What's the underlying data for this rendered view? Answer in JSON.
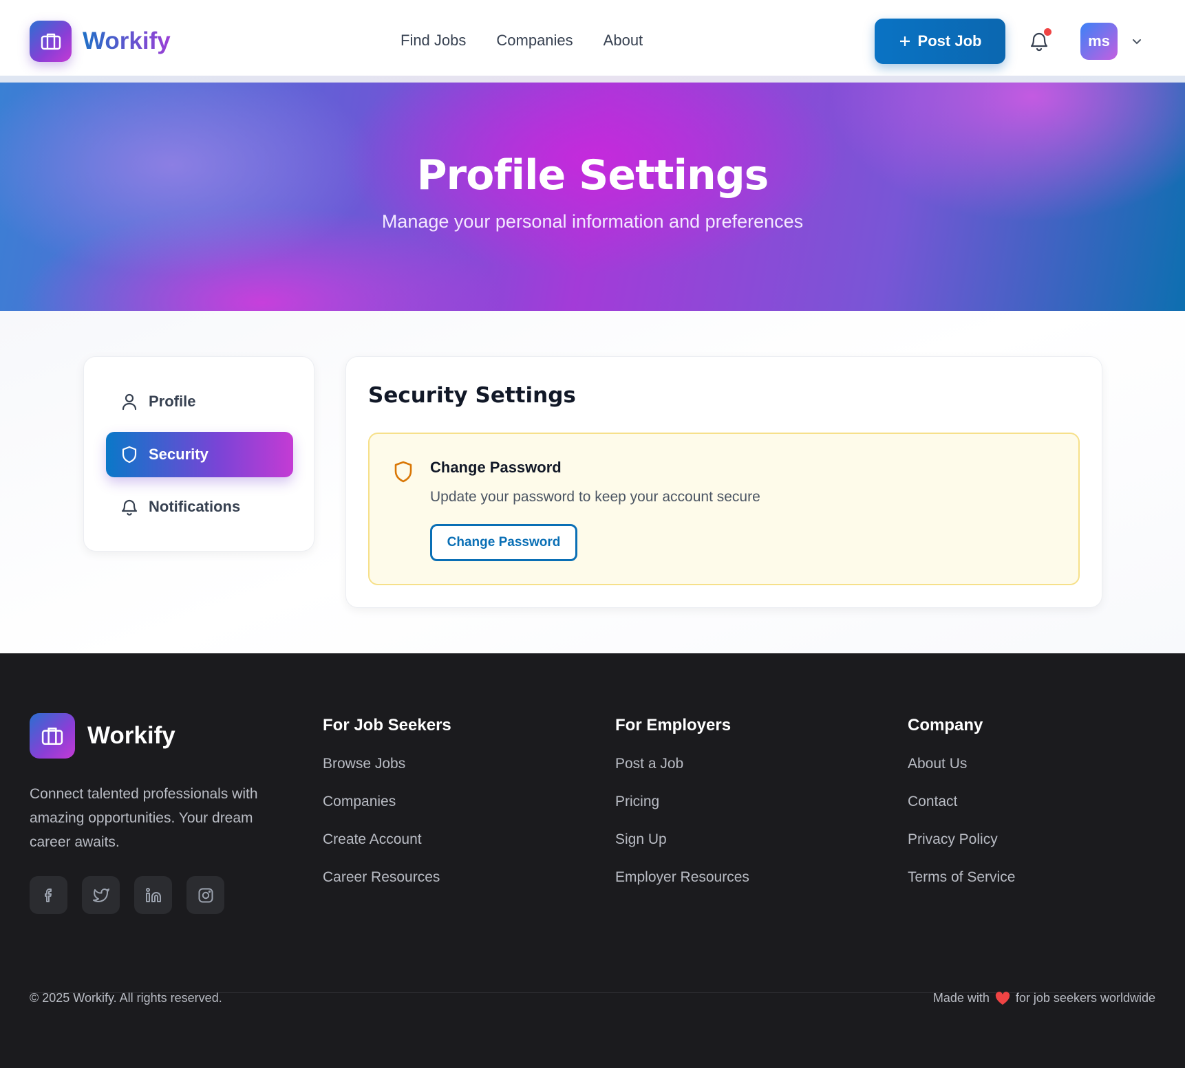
{
  "header": {
    "brand": "Workify",
    "nav": [
      "Find Jobs",
      "Companies",
      "About"
    ],
    "post_job_label": "Post Job",
    "avatar_initials": "ms",
    "notification_dot_color": "#ef4444"
  },
  "hero": {
    "title": "Profile Settings",
    "subtitle": "Manage your personal information and preferences"
  },
  "sidebar": {
    "items": [
      {
        "label": "Profile",
        "icon": "user-icon",
        "active": false
      },
      {
        "label": "Security",
        "icon": "shield-icon",
        "active": true
      },
      {
        "label": "Notifications",
        "icon": "bell-icon",
        "active": false
      }
    ]
  },
  "security": {
    "title": "Security Settings",
    "change_password": {
      "title": "Change Password",
      "description": "Update your password to keep your account secure",
      "button_label": "Change Password"
    }
  },
  "footer": {
    "brand": "Workify",
    "description": "Connect talented professionals with amazing opportunities. Your dream career awaits.",
    "socials": [
      "facebook-icon",
      "twitter-icon",
      "linkedin-icon",
      "instagram-icon"
    ],
    "columns": [
      {
        "title": "For Job Seekers",
        "links": [
          "Browse Jobs",
          "Companies",
          "Create Account",
          "Career Resources"
        ]
      },
      {
        "title": "For Employers",
        "links": [
          "Post a Job",
          "Pricing",
          "Sign Up",
          "Employer Resources"
        ]
      },
      {
        "title": "Company",
        "links": [
          "About Us",
          "Contact",
          "Privacy Policy",
          "Terms of Service"
        ]
      }
    ],
    "copyright": "© 2025 Workify. All rights reserved.",
    "made_with_prefix": "Made with",
    "made_with_suffix": "for job seekers worldwide"
  },
  "colors": {
    "primary": "#0a73c4",
    "accent": "#c43bd4",
    "footer_bg": "#1b1b1e",
    "warning_bg": "#fefbea",
    "warning_border": "#f6e08a"
  }
}
